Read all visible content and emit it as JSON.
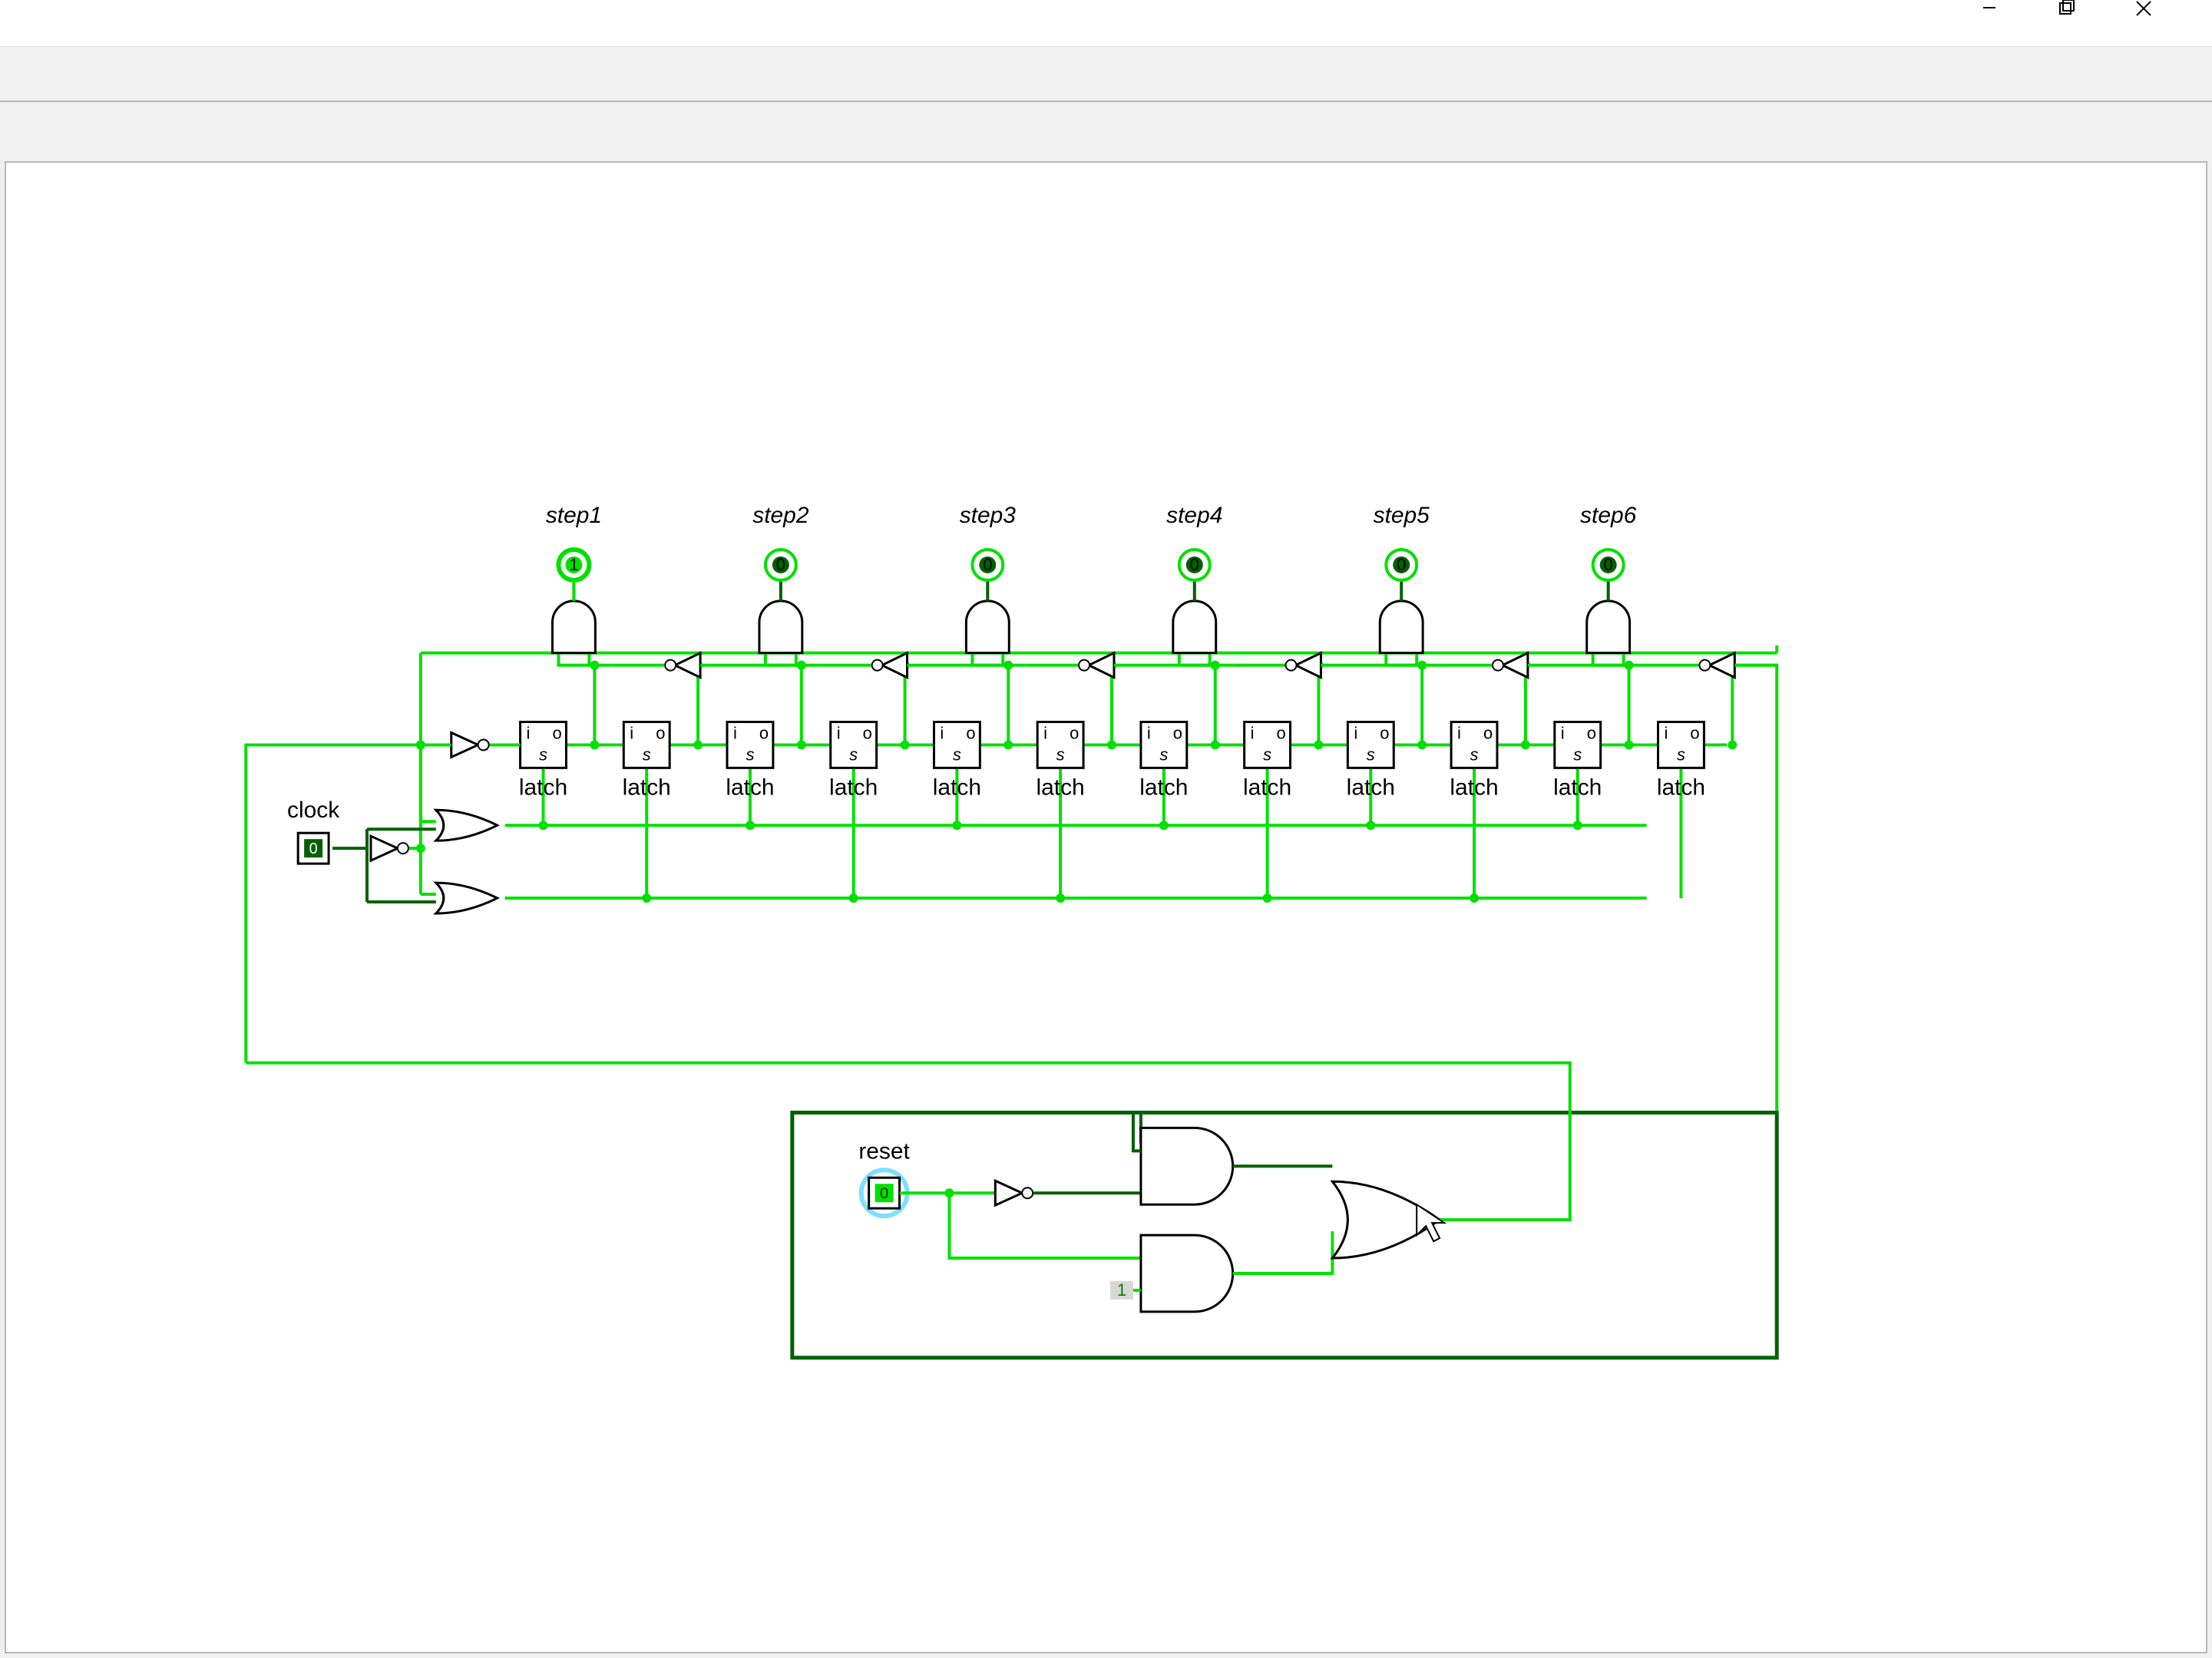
{
  "window": {
    "minimize_label": "Minimize",
    "maximize_label": "Maximize",
    "close_label": "Close"
  },
  "diagram": {
    "clock_label": "clock",
    "reset_label": "reset",
    "clock_value": "0",
    "reset_value": "0",
    "const1_value": "1",
    "latch_label": "latch",
    "latch_in": "i",
    "latch_out": "o",
    "latch_set": "s",
    "steps": [
      {
        "label": "step1",
        "led": "1"
      },
      {
        "label": "step2",
        "led": "0"
      },
      {
        "label": "step3",
        "led": "0"
      },
      {
        "label": "step4",
        "led": "0"
      },
      {
        "label": "step5",
        "led": "0"
      },
      {
        "label": "step6",
        "led": "0"
      }
    ]
  }
}
